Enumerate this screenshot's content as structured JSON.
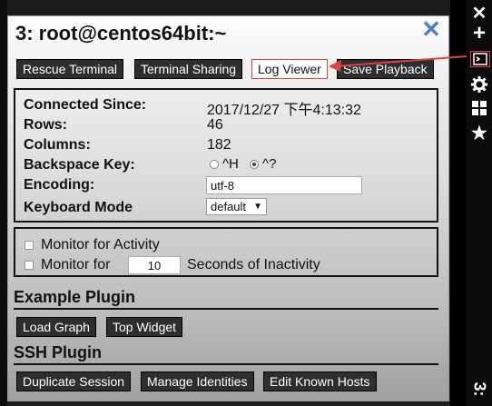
{
  "dialog": {
    "title": "3: root@centos64bit:~",
    "close_glyph": "✕"
  },
  "toolbar": {
    "rescue_terminal": "Rescue Terminal",
    "terminal_sharing": "Terminal Sharing",
    "log_viewer": "Log Viewer",
    "save_playback": "Save Playback"
  },
  "info": {
    "connected_since_label": "Connected Since:",
    "connected_since_value": "2017/12/27 下午4:13:32",
    "rows_label": "Rows:",
    "rows_value": "46",
    "columns_label": "Columns:",
    "columns_value": "182",
    "backspace_label": "Backspace Key:",
    "backspace_option_1": "^H",
    "backspace_option_2": "^?",
    "encoding_label": "Encoding:",
    "encoding_value": "utf-8",
    "keyboard_mode_label": "Keyboard Mode",
    "keyboard_mode_value": "default"
  },
  "monitor": {
    "activity_label": "Monitor for Activity",
    "inactivity_prefix": "Monitor for",
    "inactivity_value": "10",
    "inactivity_suffix": "Seconds of Inactivity"
  },
  "example_plugin": {
    "heading": "Example Plugin",
    "load_graph": "Load Graph",
    "top_widget": "Top Widget"
  },
  "ssh_plugin": {
    "heading": "SSH Plugin",
    "duplicate_session": "Duplicate Session",
    "manage_identities": "Manage Identities",
    "edit_known_hosts": "Edit Known Hosts"
  },
  "sidebar": {
    "number_label": "3:"
  },
  "colors": {
    "accent": "#4f7fc7",
    "highlight": "#e04040",
    "button_bg": "#2e2e2e"
  }
}
